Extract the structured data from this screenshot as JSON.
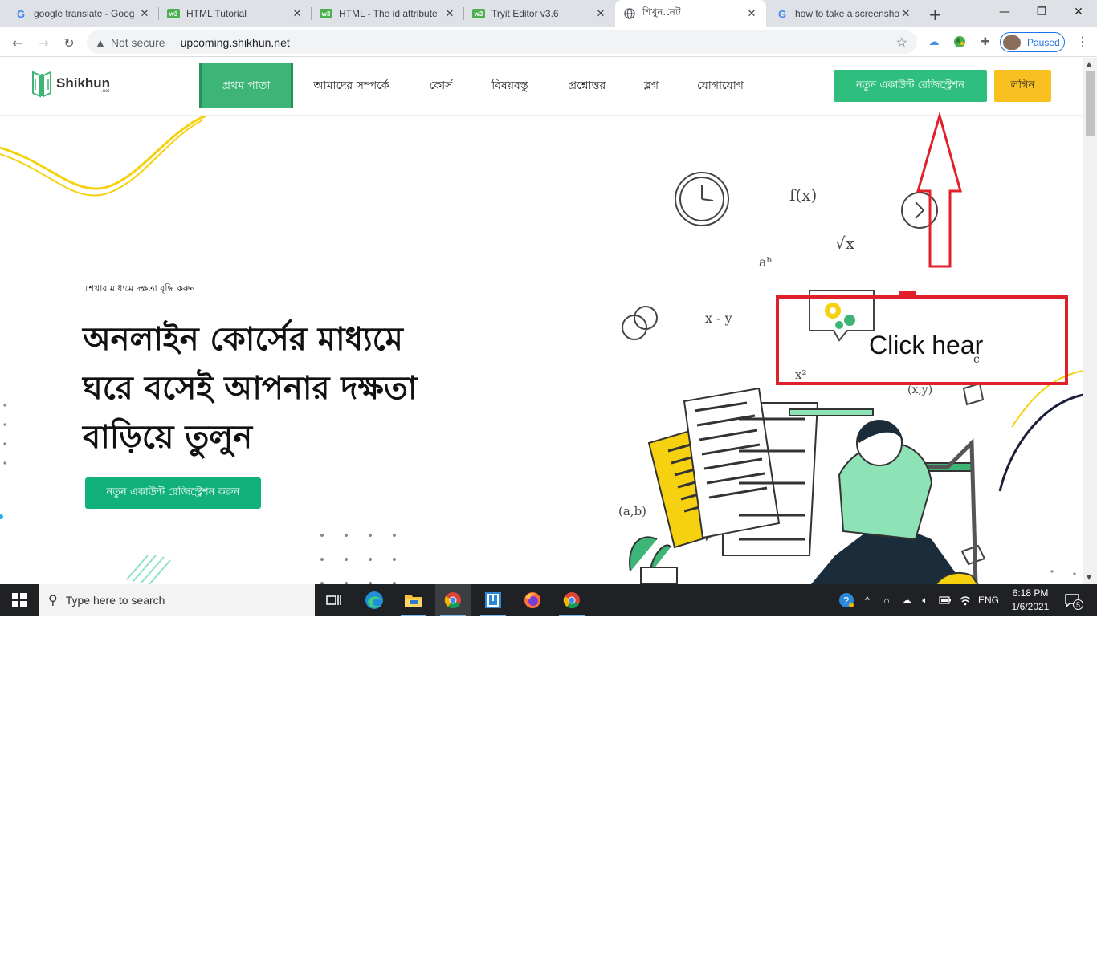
{
  "browser": {
    "tabs": [
      {
        "title": "google translate - Goog",
        "favicon": "google-favicon"
      },
      {
        "title": "HTML Tutorial",
        "favicon": "w3schools-favicon"
      },
      {
        "title": "HTML - The id attribute",
        "favicon": "w3schools-favicon"
      },
      {
        "title": "Tryit Editor v3.6",
        "favicon": "w3schools-favicon"
      },
      {
        "title": "শিখুন.নেট",
        "favicon": "globe-favicon",
        "active": true
      },
      {
        "title": "how to take a screensho",
        "favicon": "google-favicon"
      }
    ],
    "not_secure": "Not secure",
    "url": "upcoming.shikhun.net",
    "profile_status": "Paused"
  },
  "site": {
    "logo_text": "Shikhun",
    "logo_sub": ".net",
    "nav": [
      {
        "label": "প্রথম পাতা",
        "active": true
      },
      {
        "label": "আমাদের সম্পর্কে"
      },
      {
        "label": "কোর্স"
      },
      {
        "label": "বিষয়বস্তু"
      },
      {
        "label": "প্রশ্নোত্তর"
      },
      {
        "label": "ব্লগ"
      },
      {
        "label": "যোগাযোগ"
      }
    ],
    "register_button": "নতুন একাউন্ট রেজিস্ট্রেশন",
    "login_button": "লগিন",
    "colors": {
      "green": "#2ebf7f",
      "active_nav": "#3db577",
      "yellow": "#f9c021",
      "annotation_red": "#e0212b"
    }
  },
  "hero": {
    "subtitle": "শেখার মাধ্যমে দক্ষতা বৃদ্ধি করুন",
    "title_lines": [
      "অনলাইন কোর্সের মাধ্যমে",
      "ঘরে বসেই আপনার দক্ষতা",
      "বাড়িয়ে তুলুন"
    ],
    "cta": "নতুন একাউন্ট রেজিস্ট্রেশন করুন"
  },
  "annotation": {
    "text": "Click hear"
  },
  "taskbar": {
    "search_placeholder": "Type here to search",
    "language": "ENG",
    "time": "6:18 PM",
    "date": "1/6/2021",
    "notifications": "5"
  }
}
